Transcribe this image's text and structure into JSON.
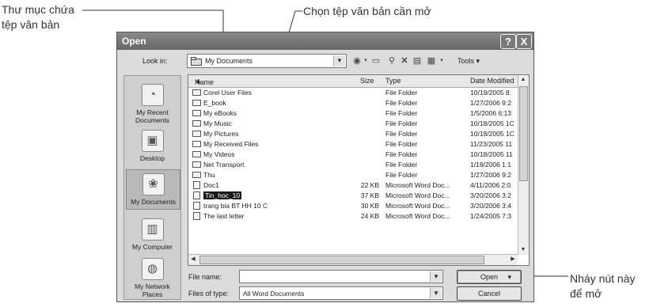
{
  "annotations": {
    "folder_line1": "Thư mục chứa",
    "folder_line2": "tệp văn bản",
    "select_file": "Chọn tệp văn bản cần mở",
    "open_line1": "Nháy nút này",
    "open_line2": "để mở"
  },
  "dialog": {
    "title": "Open",
    "help_glyph": "?",
    "close_glyph": "X"
  },
  "look_in": {
    "label": "Look in:",
    "value": "My Documents"
  },
  "toolbar": {
    "tools_label": "Tools"
  },
  "places": [
    {
      "label": "My Recent Documents",
      "icon": "recent-documents-icon"
    },
    {
      "label": "Desktop",
      "icon": "desktop-icon"
    },
    {
      "label": "My Documents",
      "icon": "my-documents-icon"
    },
    {
      "label": "My Computer",
      "icon": "my-computer-icon"
    },
    {
      "label": "My Network Places",
      "icon": "network-places-icon"
    }
  ],
  "file_list": {
    "columns": [
      "Name",
      "Size",
      "Type",
      "Date Modified"
    ],
    "rows": [
      {
        "name": "Corel User Files",
        "size": "",
        "type": "File Folder",
        "date": "10/19/2005 8:",
        "icon": "folder-icon"
      },
      {
        "name": "E_book",
        "size": "",
        "type": "File Folder",
        "date": "1/27/2006 9:2",
        "icon": "folder-icon"
      },
      {
        "name": "My eBooks",
        "size": "",
        "type": "File Folder",
        "date": "1/5/2006 6:13",
        "icon": "folder-icon"
      },
      {
        "name": "My Music",
        "size": "",
        "type": "File Folder",
        "date": "10/18/2005 1C",
        "icon": "music-folder-icon"
      },
      {
        "name": "My Pictures",
        "size": "",
        "type": "File Folder",
        "date": "10/18/2005 1C",
        "icon": "pictures-folder-icon"
      },
      {
        "name": "My Received Files",
        "size": "",
        "type": "File Folder",
        "date": "11/23/2005 11",
        "icon": "folder-icon"
      },
      {
        "name": "My Videos",
        "size": "",
        "type": "File Folder",
        "date": "10/18/2005 11",
        "icon": "videos-folder-icon"
      },
      {
        "name": "Net Transport",
        "size": "",
        "type": "File Folder",
        "date": "1/18/2006 1:1",
        "icon": "folder-icon"
      },
      {
        "name": "Thu",
        "size": "",
        "type": "File Folder",
        "date": "1/27/2006 9:2",
        "icon": "folder-icon"
      },
      {
        "name": "Doc1",
        "size": "22 KB",
        "type": "Microsoft Word Doc...",
        "date": "4/11/2006 2:0",
        "icon": "word-document-icon"
      },
      {
        "name": "Tin_hoc_10",
        "size": "37 KB",
        "type": "Microsoft Word Doc...",
        "date": "3/20/2006 3:2",
        "icon": "word-document-icon",
        "selected": true
      },
      {
        "name": "trang bia BT HH 10 C",
        "size": "30 KB",
        "type": "Microsoft Word Doc...",
        "date": "3/20/2006 3:4",
        "icon": "word-document-icon"
      },
      {
        "name": "The last letter",
        "size": "24 KB",
        "type": "Microsoft Word Doc...",
        "date": "1/24/2005 7:3",
        "icon": "word-document-icon"
      }
    ]
  },
  "file_name": {
    "label": "File name:",
    "value": ""
  },
  "file_type": {
    "label": "Files of type:",
    "value": "All Word Documents"
  },
  "buttons": {
    "open": "Open",
    "cancel": "Cancel"
  }
}
